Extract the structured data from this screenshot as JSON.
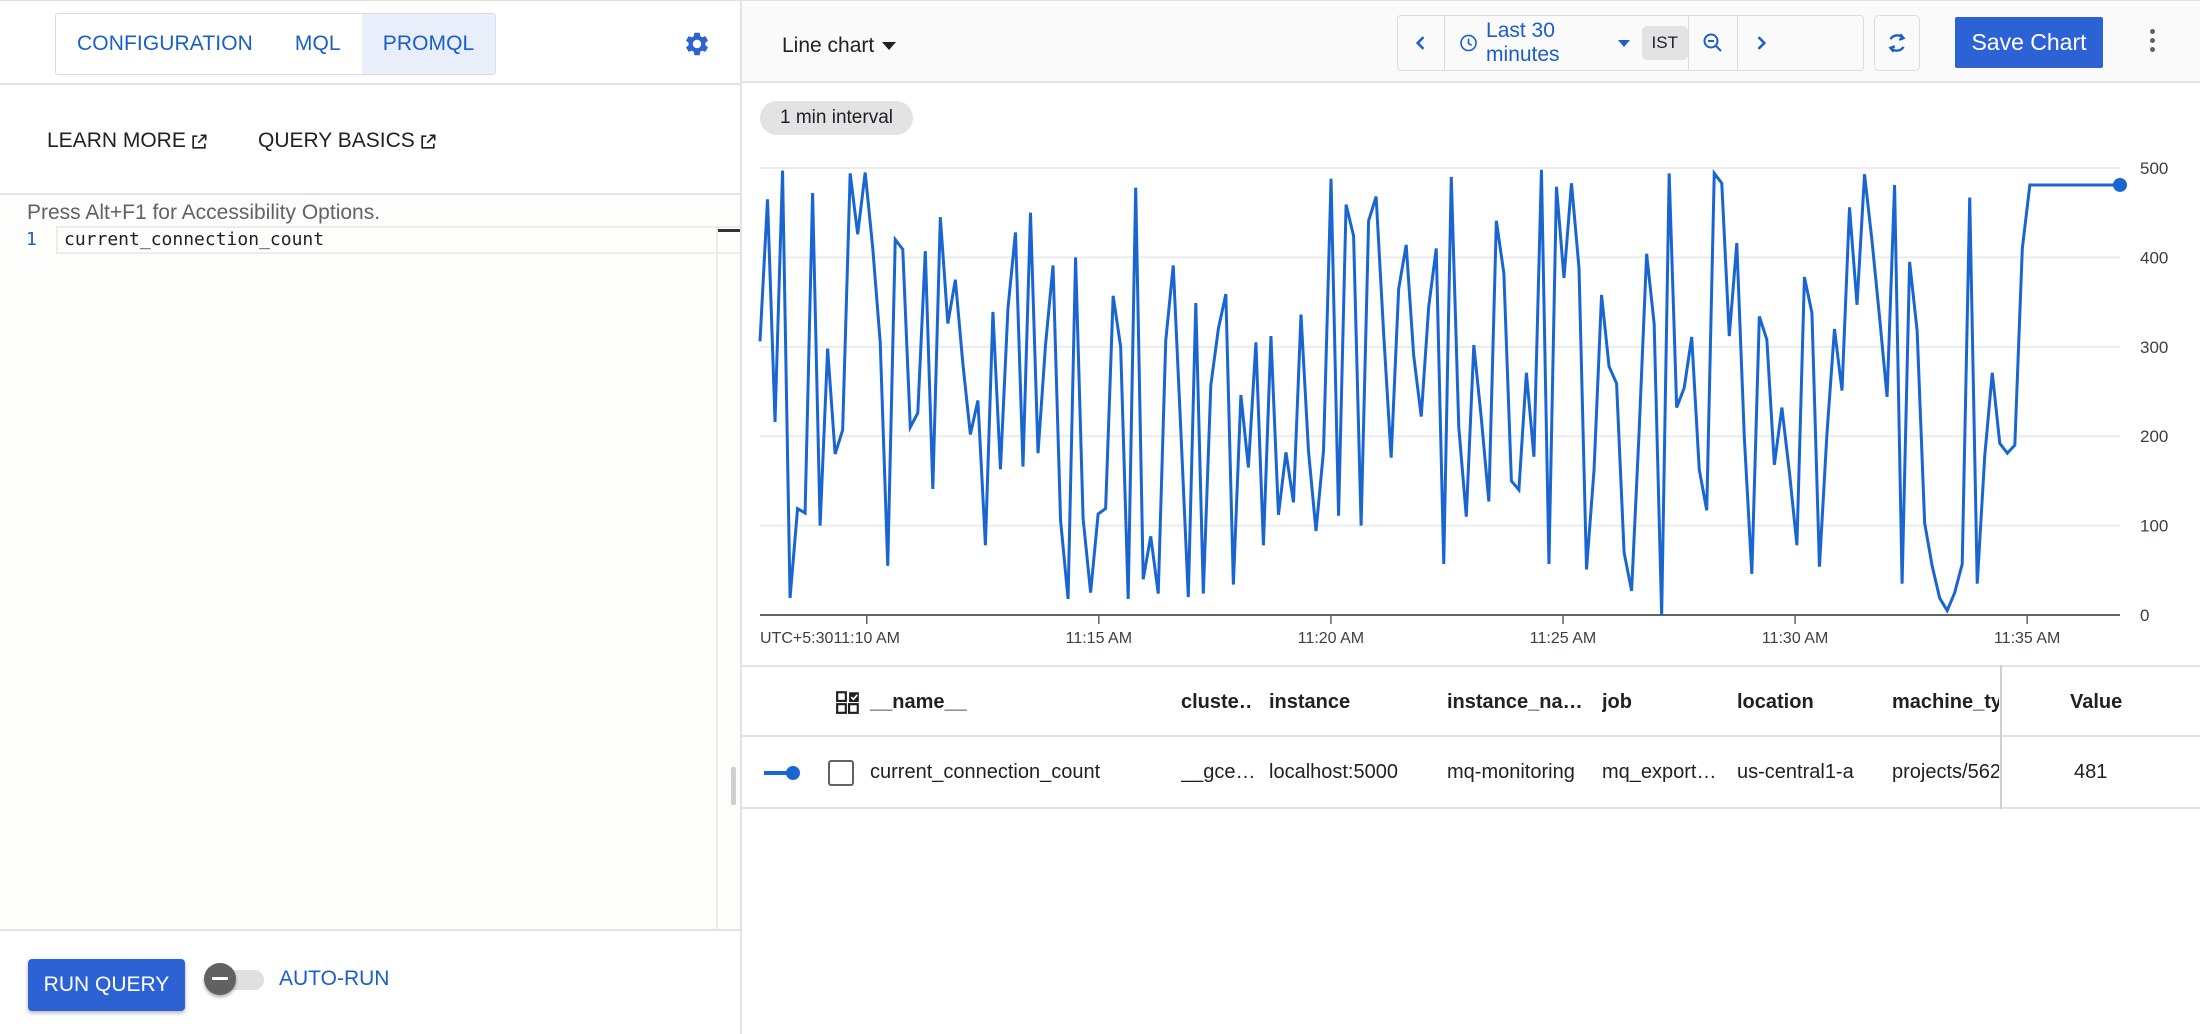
{
  "left_panel": {
    "tabs": [
      {
        "label": "CONFIGURATION",
        "active": false
      },
      {
        "label": "MQL",
        "active": false
      },
      {
        "label": "PROMQL",
        "active": true
      }
    ],
    "settings_icon": "gear-icon",
    "links": [
      {
        "label": "LEARN MORE",
        "icon": "open-in-new-icon"
      },
      {
        "label": "QUERY BASICS",
        "icon": "open-in-new-icon"
      }
    ],
    "editor": {
      "accessibility_hint": "Press Alt+F1 for Accessibility Options.",
      "lines": [
        {
          "number": "1",
          "text": "current_connection_count"
        }
      ]
    },
    "run_query_label": "RUN QUERY",
    "auto_run": {
      "label": "AUTO-RUN",
      "enabled": false
    }
  },
  "toolbar": {
    "chart_type": "Line chart",
    "time_range": "Last 30 minutes",
    "timezone": "IST",
    "save_label": "Save Chart",
    "icons": {
      "prev": "chevron-left-icon",
      "clock": "clock-icon",
      "zoom_out": "zoom-out-icon",
      "next": "chevron-right-icon",
      "refresh": "auto-refresh-icon",
      "more": "more-vert-icon"
    }
  },
  "interval_chip": "1 min interval",
  "colors": {
    "accent": "#2c62d4",
    "series": "#1966d2",
    "link": "#1a5fc7"
  },
  "chart_data": {
    "type": "line",
    "title": "",
    "xlabel": "",
    "ylabel": "",
    "timezone_label": "UTC+5:30",
    "x_start_minutes": 7.7,
    "x_end_minutes": 37.0,
    "x_ticks": [
      {
        "minute": 10,
        "label": "11:10 AM"
      },
      {
        "minute": 15,
        "label": "11:15 AM"
      },
      {
        "minute": 20,
        "label": "11:20 AM"
      },
      {
        "minute": 25,
        "label": "11:25 AM"
      },
      {
        "minute": 30,
        "label": "11:30 AM"
      },
      {
        "minute": 35,
        "label": "11:35 AM"
      }
    ],
    "y_ticks": [
      0,
      100,
      200,
      300,
      400,
      500
    ],
    "ylim": [
      0,
      500
    ],
    "grid": true,
    "series": [
      {
        "name": "current_connection_count",
        "values": [
          306,
          465,
          216,
          497,
          19,
          119,
          114,
          472,
          100,
          298,
          180,
          207,
          494,
          426,
          495,
          411,
          305,
          55,
          420,
          409,
          210,
          226,
          407,
          141,
          445,
          326,
          375,
          281,
          202,
          240,
          78,
          339,
          163,
          343,
          428,
          166,
          450,
          181,
          302,
          391,
          106,
          18,
          400,
          108,
          25,
          113,
          119,
          357,
          300,
          18,
          478,
          40,
          88,
          24,
          307,
          391,
          208,
          20,
          349,
          24,
          257,
          320,
          359,
          34,
          246,
          165,
          305,
          78,
          312,
          112,
          182,
          126,
          336,
          183,
          94,
          184,
          488,
          111,
          459,
          424,
          100,
          441,
          468,
          315,
          176,
          365,
          414,
          290,
          222,
          345,
          410,
          57,
          490,
          210,
          110,
          302,
          220,
          127,
          441,
          382,
          150,
          140,
          271,
          177,
          498,
          57,
          479,
          377,
          483,
          388,
          51,
          162,
          358,
          278,
          259,
          70,
          27,
          205,
          404,
          326,
          0,
          494,
          232,
          254,
          311,
          163,
          117,
          494,
          483,
          312,
          416,
          199,
          46,
          334,
          308,
          168,
          232,
          160,
          78,
          378,
          338,
          54,
          203,
          320,
          251,
          456,
          347,
          493,
          418,
          333,
          244,
          481,
          35,
          395,
          318,
          103,
          55,
          19,
          5,
          25,
          57,
          467,
          35,
          178,
          271,
          192,
          181,
          190,
          410,
          481,
          481,
          481,
          481,
          481,
          481,
          481,
          481,
          481,
          481,
          481,
          481,
          481
        ]
      }
    ]
  },
  "table": {
    "columns": [
      "__name__",
      "cluste…",
      "instance",
      "instance_na…",
      "job",
      "location",
      "machine_typ",
      "Value"
    ],
    "rows": [
      {
        "cells": [
          "current_connection_count",
          "__gce…",
          "localhost:5000",
          "mq-monitoring",
          "mq_export…",
          "us-central1-a",
          "projects/562",
          "481"
        ],
        "selected": false
      }
    ],
    "column_picker_icon": "column-picker-icon"
  }
}
